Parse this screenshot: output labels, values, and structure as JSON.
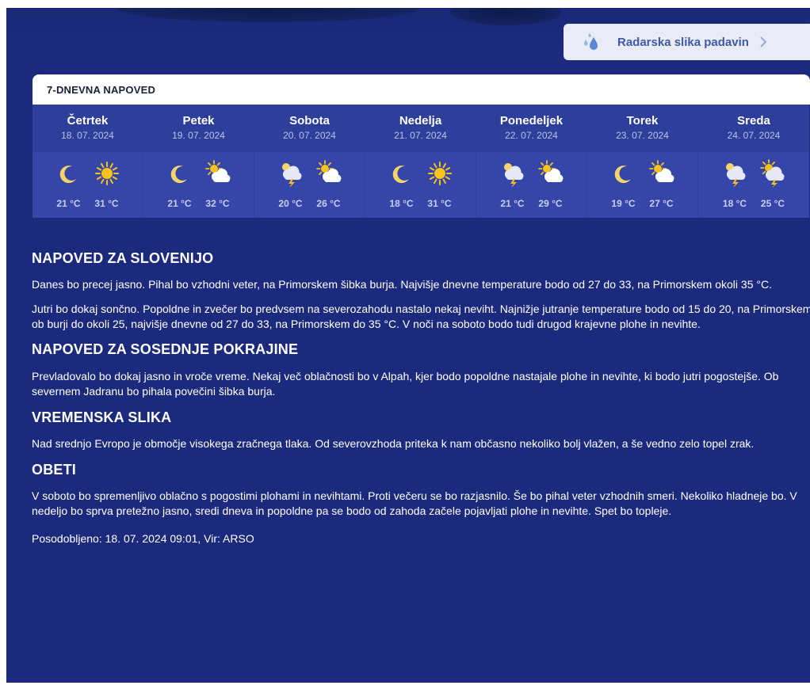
{
  "radar": {
    "label": "Radarska slika padavin",
    "icon": "raindrops-icon"
  },
  "forecast": {
    "title": "7-DNEVNA NAPOVED",
    "days": [
      {
        "name": "Četrtek",
        "date": "18. 07. 2024",
        "night_icon": "moon-icon",
        "day_icon": "sun-icon",
        "min": "21 °C",
        "max": "31 °C"
      },
      {
        "name": "Petek",
        "date": "19. 07. 2024",
        "night_icon": "moon-icon",
        "day_icon": "sun-cloud-icon",
        "min": "21 °C",
        "max": "32 °C"
      },
      {
        "name": "Sobota",
        "date": "20. 07. 2024",
        "night_icon": "storm-icon",
        "day_icon": "sun-cloud-icon",
        "min": "20 °C",
        "max": "26 °C"
      },
      {
        "name": "Nedelja",
        "date": "21. 07. 2024",
        "night_icon": "moon-icon",
        "day_icon": "sun-icon",
        "min": "18 °C",
        "max": "31 °C"
      },
      {
        "name": "Ponedeljek",
        "date": "22. 07. 2024",
        "night_icon": "storm-icon",
        "day_icon": "sun-cloud-icon",
        "min": "21 °C",
        "max": "29 °C"
      },
      {
        "name": "Torek",
        "date": "23. 07. 2024",
        "night_icon": "moon-icon",
        "day_icon": "sun-cloud-icon",
        "min": "19 °C",
        "max": "27 °C"
      },
      {
        "name": "Sreda",
        "date": "24. 07. 2024",
        "night_icon": "storm-icon",
        "day_icon": "sun-storm-icon",
        "min": "18 °C",
        "max": "25 °C"
      }
    ]
  },
  "sections": {
    "slovenia": {
      "title": "NAPOVED ZA SLOVENIJO",
      "p1": "Danes bo precej jasno. Pihal bo vzhodni veter, na Primorskem šibka burja. Najvišje dnevne temperature bodo od 27 do 33, na Primorskem okoli 35 °C.",
      "p2": "Jutri bo dokaj sončno. Popoldne in zvečer bo predvsem na severozahodu nastalo nekaj neviht. Najnižje jutranje temperature bodo od 15 do 20, na Primorskem ob burji do okoli 25, najvišje dnevne od 27 do 33, na Primorskem do 35 °C. V noči na soboto bodo tudi drugod krajevne plohe in nevihte."
    },
    "neighbours": {
      "title": "NAPOVED ZA SOSEDNJE POKRAJINE",
      "p1": "Prevladovalo bo dokaj jasno in vroče vreme. Nekaj več oblačnosti bo v Alpah, kjer bodo popoldne nastajale plohe in nevihte, ki bodo jutri pogostejše. Ob severnem Jadranu bo pihala povečini šibka burja."
    },
    "picture": {
      "title": "VREMENSKA SLIKA",
      "p1": "Nad srednjo Evropo je območje visokega zračnega tlaka. Od severovzhoda priteka k nam občasno nekoliko bolj vlažen, a še vedno zelo topel zrak."
    },
    "outlook": {
      "title": "OBETI",
      "p1": "V soboto bo spremenljivo oblačno s pogostimi plohami in nevihtami. Proti večeru se bo razjasnilo. Še bo pihal veter vzhodnih smeri. Nekoliko hladneje bo. V nedeljo bo sprva pretežno jasno, sredi dneva in popoldne pa se bodo od zahoda začele pojavljati plohe in nevihte. Spet bo topleje."
    }
  },
  "footer": {
    "updated": "Posodobljeno: 18. 07. 2024 09:01, Vir: ARSO"
  },
  "colors": {
    "background": "#1b2a7c",
    "day_header": "#2d3f9a",
    "day_icons": "#3545a8",
    "sun": "#f6c21c",
    "moon": "#f6d36a",
    "cloud": "#ffffff",
    "radar_text": "#3e5aa8"
  }
}
